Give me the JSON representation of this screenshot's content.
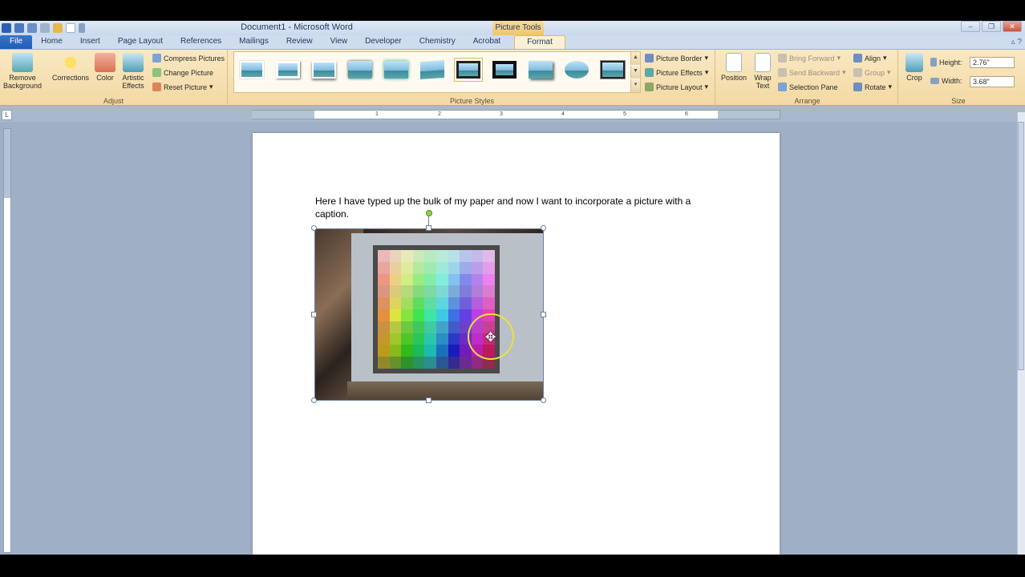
{
  "app": {
    "title": "Document1 - Microsoft Word",
    "contextual_tab_group": "Picture Tools"
  },
  "tabs": [
    {
      "label": "File",
      "kind": "file"
    },
    {
      "label": "Home"
    },
    {
      "label": "Insert"
    },
    {
      "label": "Page Layout"
    },
    {
      "label": "References"
    },
    {
      "label": "Mailings"
    },
    {
      "label": "Review"
    },
    {
      "label": "View"
    },
    {
      "label": "Developer"
    },
    {
      "label": "Chemistry"
    },
    {
      "label": "Acrobat"
    },
    {
      "label": "Format",
      "active": true
    }
  ],
  "ribbon": {
    "adjust": {
      "label": "Adjust",
      "remove_background": "Remove Background",
      "corrections": "Corrections",
      "color": "Color",
      "artistic_effects": "Artistic Effects",
      "compress": "Compress Pictures",
      "change": "Change Picture",
      "reset": "Reset Picture"
    },
    "picture_styles": {
      "label": "Picture Styles",
      "border": "Picture Border",
      "effects": "Picture Effects",
      "layout": "Picture Layout"
    },
    "arrange": {
      "label": "Arrange",
      "position": "Position",
      "wrap_text": "Wrap Text",
      "bring_forward": "Bring Forward",
      "send_backward": "Send Backward",
      "selection_pane": "Selection Pane",
      "align": "Align",
      "group": "Group",
      "rotate": "Rotate"
    },
    "size": {
      "label": "Size",
      "crop": "Crop",
      "height_label": "Height:",
      "height_value": "2.76\"",
      "width_label": "Width:",
      "width_value": "3.68\""
    }
  },
  "ruler": {
    "numbers": [
      "1",
      "1",
      "2",
      "3",
      "4",
      "5",
      "6",
      "7"
    ]
  },
  "document": {
    "paragraph": "Here I have typed up the bulk of my paper and now I want to incorporate a picture with a caption."
  },
  "colors": {
    "ribbon": "#f6dfae",
    "file_tab": "#2a63b8",
    "workspace": "#9fb0c6",
    "contextual": "#efc56a"
  }
}
